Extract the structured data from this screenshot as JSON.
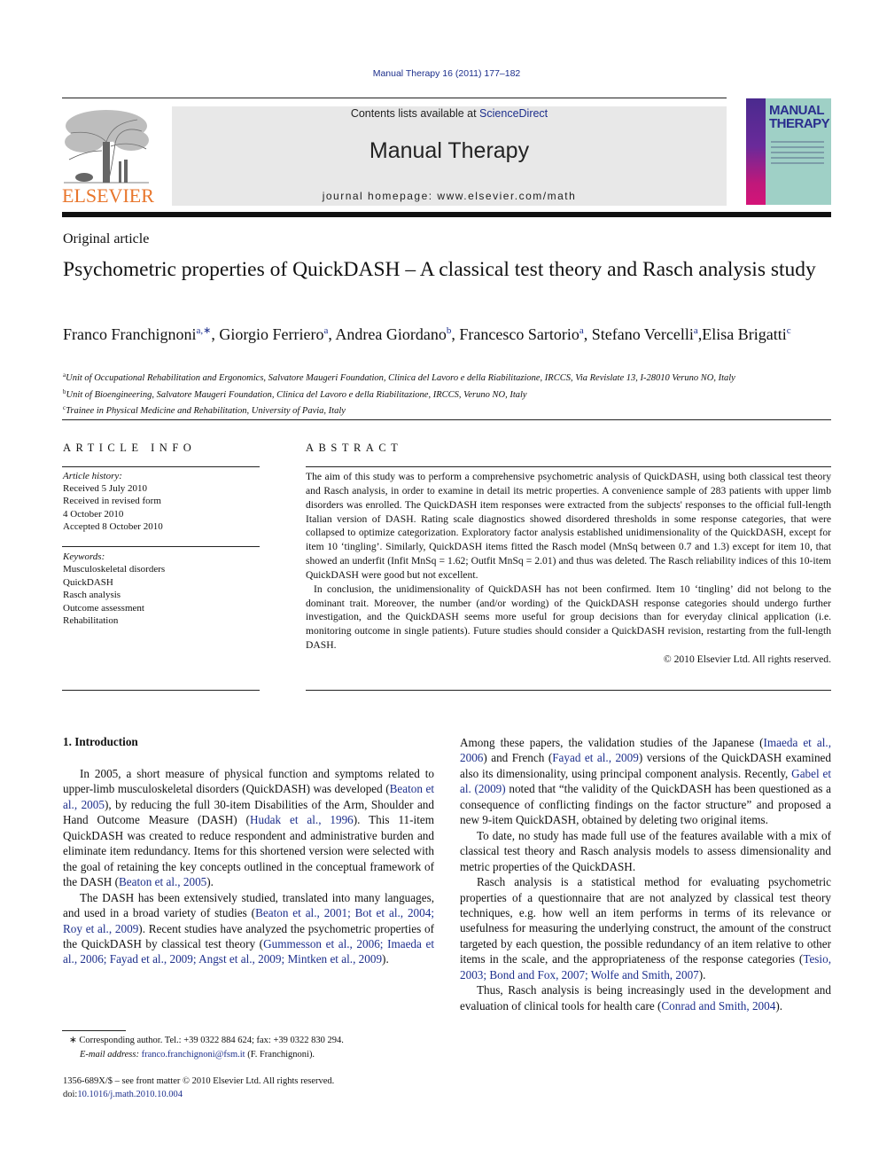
{
  "header": {
    "citation": "Manual Therapy 16 (2011) 177–182",
    "contents_prefix": "Contents lists available at ",
    "contents_link": "ScienceDirect",
    "journal_name": "Manual Therapy",
    "homepage": "journal homepage: www.elsevier.com/math",
    "publisher_logo_text": "ELSEVIER",
    "cover_title_line1": "MANUAL",
    "cover_title_line2": "THERAPY"
  },
  "colors": {
    "link": "#1d2f8c",
    "elsevier_orange": "#e8762c",
    "header_box": "#e8e8e8"
  },
  "article": {
    "type": "Original article",
    "title": "Psychometric properties of QuickDASH – A classical test theory and Rasch analysis study",
    "authors": [
      {
        "name": "Franco Franchignoni",
        "sup": "a,∗",
        "sep": ", "
      },
      {
        "name": "Giorgio Ferriero",
        "sup": "a",
        "sep": ", "
      },
      {
        "name": "Andrea Giordano",
        "sup": "b",
        "sep": ", "
      },
      {
        "name": "Francesco Sartorio",
        "sup": "a",
        "sep": ", "
      },
      {
        "name": "Stefano Vercelli",
        "sup": "a",
        "sep": ","
      },
      {
        "name": "Elisa Brigatti",
        "sup": "c",
        "sep": ""
      }
    ],
    "affiliations": [
      {
        "mark": "a",
        "text": "Unit of Occupational Rehabilitation and Ergonomics, Salvatore Maugeri Foundation, Clinica del Lavoro e della Riabilitazione, IRCCS, Via Revislate 13, I-28010 Veruno NO, Italy"
      },
      {
        "mark": "b",
        "text": "Unit of Bioengineering, Salvatore Maugeri Foundation, Clinica del Lavoro e della Riabilitazione, IRCCS, Veruno NO, Italy"
      },
      {
        "mark": "c",
        "text": "Trainee in Physical Medicine and Rehabilitation, University of Pavia, Italy"
      }
    ]
  },
  "article_info": {
    "heading": "ARTICLE INFO",
    "history_label": "Article history:",
    "history": [
      "Received 5 July 2010",
      "Received in revised form",
      "4 October 2010",
      "Accepted 8 October 2010"
    ],
    "keywords_label": "Keywords:",
    "keywords": [
      "Musculoskeletal disorders",
      "QuickDASH",
      "Rasch analysis",
      "Outcome assessment",
      "Rehabilitation"
    ]
  },
  "abstract": {
    "heading": "ABSTRACT",
    "p1": "The aim of this study was to perform a comprehensive psychometric analysis of QuickDASH, using both classical test theory and Rasch analysis, in order to examine in detail its metric properties. A convenience sample of 283 patients with upper limb disorders was enrolled. The QuickDASH item responses were extracted from the subjects' responses to the official full-length Italian version of DASH. Rating scale diagnostics showed disordered thresholds in some response categories, that were collapsed to optimize categorization. Exploratory factor analysis established unidimensionality of the QuickDASH, except for item 10 ‘tingling’. Similarly, QuickDASH items fitted the Rasch model (MnSq between 0.7 and 1.3) except for item 10, that showed an underfit (Infit MnSq = 1.62; Outfit MnSq = 2.01) and thus was deleted. The Rasch reliability indices of this 10-item QuickDASH were good but not excellent.",
    "p2": "In conclusion, the unidimensionality of QuickDASH has not been confirmed. Item 10 ‘tingling’ did not belong to the dominant trait. Moreover, the number (and/or wording) of the QuickDASH response categories should undergo further investigation, and the QuickDASH seems more useful for group decisions than for everyday clinical application (i.e. monitoring outcome in single patients). Future studies should consider a QuickDASH revision, restarting from the full-length DASH.",
    "copyright": "© 2010 Elsevier Ltd. All rights reserved."
  },
  "intro": {
    "heading": "1.  Introduction",
    "left_paragraphs": [
      [
        {
          "t": "In 2005, a short measure of physical function and symptoms related to upper-limb musculoskeletal disorders (QuickDASH) was developed ("
        },
        {
          "link": "Beaton et al., 2005"
        },
        {
          "t": "), by reducing the full 30-item Disabilities of the Arm, Shoulder and Hand Outcome Measure (DASH) ("
        },
        {
          "link": "Hudak et al., 1996"
        },
        {
          "t": "). This 11-item QuickDASH was created to reduce respondent and administrative burden and eliminate item redundancy. Items for this shortened version were selected with the goal of retaining the key concepts outlined in the conceptual framework of the DASH ("
        },
        {
          "link": "Beaton et al., 2005"
        },
        {
          "t": ")."
        }
      ],
      [
        {
          "t": "The DASH has been extensively studied, translated into many languages, and used in a broad variety of studies ("
        },
        {
          "link": "Beaton et al., 2001; Bot et al., 2004; Roy et al., 2009"
        },
        {
          "t": "). Recent studies have analyzed the psychometric properties of the QuickDASH by classical test theory ("
        },
        {
          "link": "Gummesson et al., 2006; Imaeda et al., 2006; Fayad et al., 2009; Angst et al., 2009; Mintken et al., 2009"
        },
        {
          "t": ")."
        }
      ]
    ],
    "right_paragraphs": [
      [
        {
          "t": "Among these papers, the validation studies of the Japanese ("
        },
        {
          "link": "Imaeda et al., 2006"
        },
        {
          "t": ") and French ("
        },
        {
          "link": "Fayad et al., 2009"
        },
        {
          "t": ") versions of the QuickDASH examined also its dimensionality, using principal component analysis. Recently, "
        },
        {
          "link": "Gabel et al. (2009)"
        },
        {
          "t": " noted that “the validity of the QuickDASH has been questioned as a consequence of conflicting findings on the factor structure” and proposed a new 9-item QuickDASH, obtained by deleting two original items."
        }
      ],
      [
        {
          "t": "To date, no study has made full use of the features available with a mix of classical test theory and Rasch analysis models to assess dimensionality and metric properties of the QuickDASH."
        }
      ],
      [
        {
          "t": "Rasch analysis is a statistical method for evaluating psychometric properties of a questionnaire that are not analyzed by classical test theory techniques, e.g. how well an item performs in terms of its relevance or usefulness for measuring the underlying construct, the amount of the construct targeted by each question, the possible redundancy of an item relative to other items in the scale, and the appropriateness of the response categories ("
        },
        {
          "link": "Tesio, 2003; Bond and Fox, 2007; Wolfe and Smith, 2007"
        },
        {
          "t": ")."
        }
      ],
      [
        {
          "t": "Thus, Rasch analysis is being increasingly used in the development and evaluation of clinical tools for health care ("
        },
        {
          "link": "Conrad and Smith, 2004"
        },
        {
          "t": ")."
        }
      ]
    ]
  },
  "footnotes": {
    "corresponding": "∗  Corresponding author. Tel.: +39 0322 884 624; fax: +39 0322 830 294.",
    "email_label": "E-mail address:",
    "email": "franco.franchignoni@fsm.it",
    "email_suffix": " (F. Franchignoni).",
    "issn": "1356-689X/$ – see front matter © 2010 Elsevier Ltd. All rights reserved.",
    "doi_label": "doi:",
    "doi": "10.1016/j.math.2010.10.004"
  }
}
